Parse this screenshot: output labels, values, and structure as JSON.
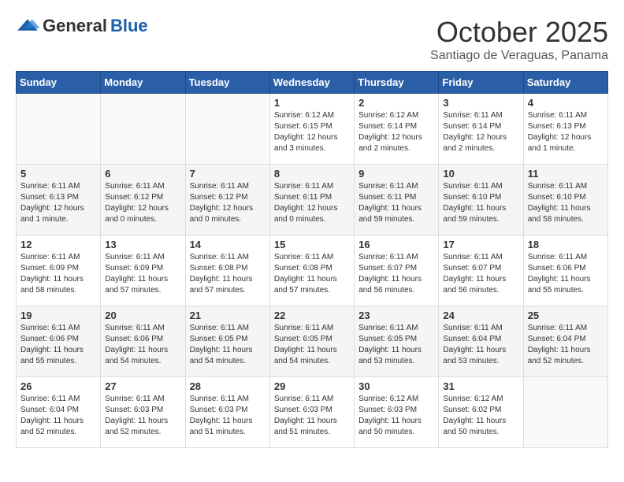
{
  "logo": {
    "general": "General",
    "blue": "Blue"
  },
  "title": "October 2025",
  "subtitle": "Santiago de Veraguas, Panama",
  "days_of_week": [
    "Sunday",
    "Monday",
    "Tuesday",
    "Wednesday",
    "Thursday",
    "Friday",
    "Saturday"
  ],
  "weeks": [
    [
      {
        "day": "",
        "text": ""
      },
      {
        "day": "",
        "text": ""
      },
      {
        "day": "",
        "text": ""
      },
      {
        "day": "1",
        "text": "Sunrise: 6:12 AM\nSunset: 6:15 PM\nDaylight: 12 hours and 3 minutes."
      },
      {
        "day": "2",
        "text": "Sunrise: 6:12 AM\nSunset: 6:14 PM\nDaylight: 12 hours and 2 minutes."
      },
      {
        "day": "3",
        "text": "Sunrise: 6:11 AM\nSunset: 6:14 PM\nDaylight: 12 hours and 2 minutes."
      },
      {
        "day": "4",
        "text": "Sunrise: 6:11 AM\nSunset: 6:13 PM\nDaylight: 12 hours and 1 minute."
      }
    ],
    [
      {
        "day": "5",
        "text": "Sunrise: 6:11 AM\nSunset: 6:13 PM\nDaylight: 12 hours and 1 minute."
      },
      {
        "day": "6",
        "text": "Sunrise: 6:11 AM\nSunset: 6:12 PM\nDaylight: 12 hours and 0 minutes."
      },
      {
        "day": "7",
        "text": "Sunrise: 6:11 AM\nSunset: 6:12 PM\nDaylight: 12 hours and 0 minutes."
      },
      {
        "day": "8",
        "text": "Sunrise: 6:11 AM\nSunset: 6:11 PM\nDaylight: 12 hours and 0 minutes."
      },
      {
        "day": "9",
        "text": "Sunrise: 6:11 AM\nSunset: 6:11 PM\nDaylight: 11 hours and 59 minutes."
      },
      {
        "day": "10",
        "text": "Sunrise: 6:11 AM\nSunset: 6:10 PM\nDaylight: 11 hours and 59 minutes."
      },
      {
        "day": "11",
        "text": "Sunrise: 6:11 AM\nSunset: 6:10 PM\nDaylight: 11 hours and 58 minutes."
      }
    ],
    [
      {
        "day": "12",
        "text": "Sunrise: 6:11 AM\nSunset: 6:09 PM\nDaylight: 11 hours and 58 minutes."
      },
      {
        "day": "13",
        "text": "Sunrise: 6:11 AM\nSunset: 6:09 PM\nDaylight: 11 hours and 57 minutes."
      },
      {
        "day": "14",
        "text": "Sunrise: 6:11 AM\nSunset: 6:08 PM\nDaylight: 11 hours and 57 minutes."
      },
      {
        "day": "15",
        "text": "Sunrise: 6:11 AM\nSunset: 6:08 PM\nDaylight: 11 hours and 57 minutes."
      },
      {
        "day": "16",
        "text": "Sunrise: 6:11 AM\nSunset: 6:07 PM\nDaylight: 11 hours and 56 minutes."
      },
      {
        "day": "17",
        "text": "Sunrise: 6:11 AM\nSunset: 6:07 PM\nDaylight: 11 hours and 56 minutes."
      },
      {
        "day": "18",
        "text": "Sunrise: 6:11 AM\nSunset: 6:06 PM\nDaylight: 11 hours and 55 minutes."
      }
    ],
    [
      {
        "day": "19",
        "text": "Sunrise: 6:11 AM\nSunset: 6:06 PM\nDaylight: 11 hours and 55 minutes."
      },
      {
        "day": "20",
        "text": "Sunrise: 6:11 AM\nSunset: 6:06 PM\nDaylight: 11 hours and 54 minutes."
      },
      {
        "day": "21",
        "text": "Sunrise: 6:11 AM\nSunset: 6:05 PM\nDaylight: 11 hours and 54 minutes."
      },
      {
        "day": "22",
        "text": "Sunrise: 6:11 AM\nSunset: 6:05 PM\nDaylight: 11 hours and 54 minutes."
      },
      {
        "day": "23",
        "text": "Sunrise: 6:11 AM\nSunset: 6:05 PM\nDaylight: 11 hours and 53 minutes."
      },
      {
        "day": "24",
        "text": "Sunrise: 6:11 AM\nSunset: 6:04 PM\nDaylight: 11 hours and 53 minutes."
      },
      {
        "day": "25",
        "text": "Sunrise: 6:11 AM\nSunset: 6:04 PM\nDaylight: 11 hours and 52 minutes."
      }
    ],
    [
      {
        "day": "26",
        "text": "Sunrise: 6:11 AM\nSunset: 6:04 PM\nDaylight: 11 hours and 52 minutes."
      },
      {
        "day": "27",
        "text": "Sunrise: 6:11 AM\nSunset: 6:03 PM\nDaylight: 11 hours and 52 minutes."
      },
      {
        "day": "28",
        "text": "Sunrise: 6:11 AM\nSunset: 6:03 PM\nDaylight: 11 hours and 51 minutes."
      },
      {
        "day": "29",
        "text": "Sunrise: 6:11 AM\nSunset: 6:03 PM\nDaylight: 11 hours and 51 minutes."
      },
      {
        "day": "30",
        "text": "Sunrise: 6:12 AM\nSunset: 6:03 PM\nDaylight: 11 hours and 50 minutes."
      },
      {
        "day": "31",
        "text": "Sunrise: 6:12 AM\nSunset: 6:02 PM\nDaylight: 11 hours and 50 minutes."
      },
      {
        "day": "",
        "text": ""
      }
    ]
  ]
}
